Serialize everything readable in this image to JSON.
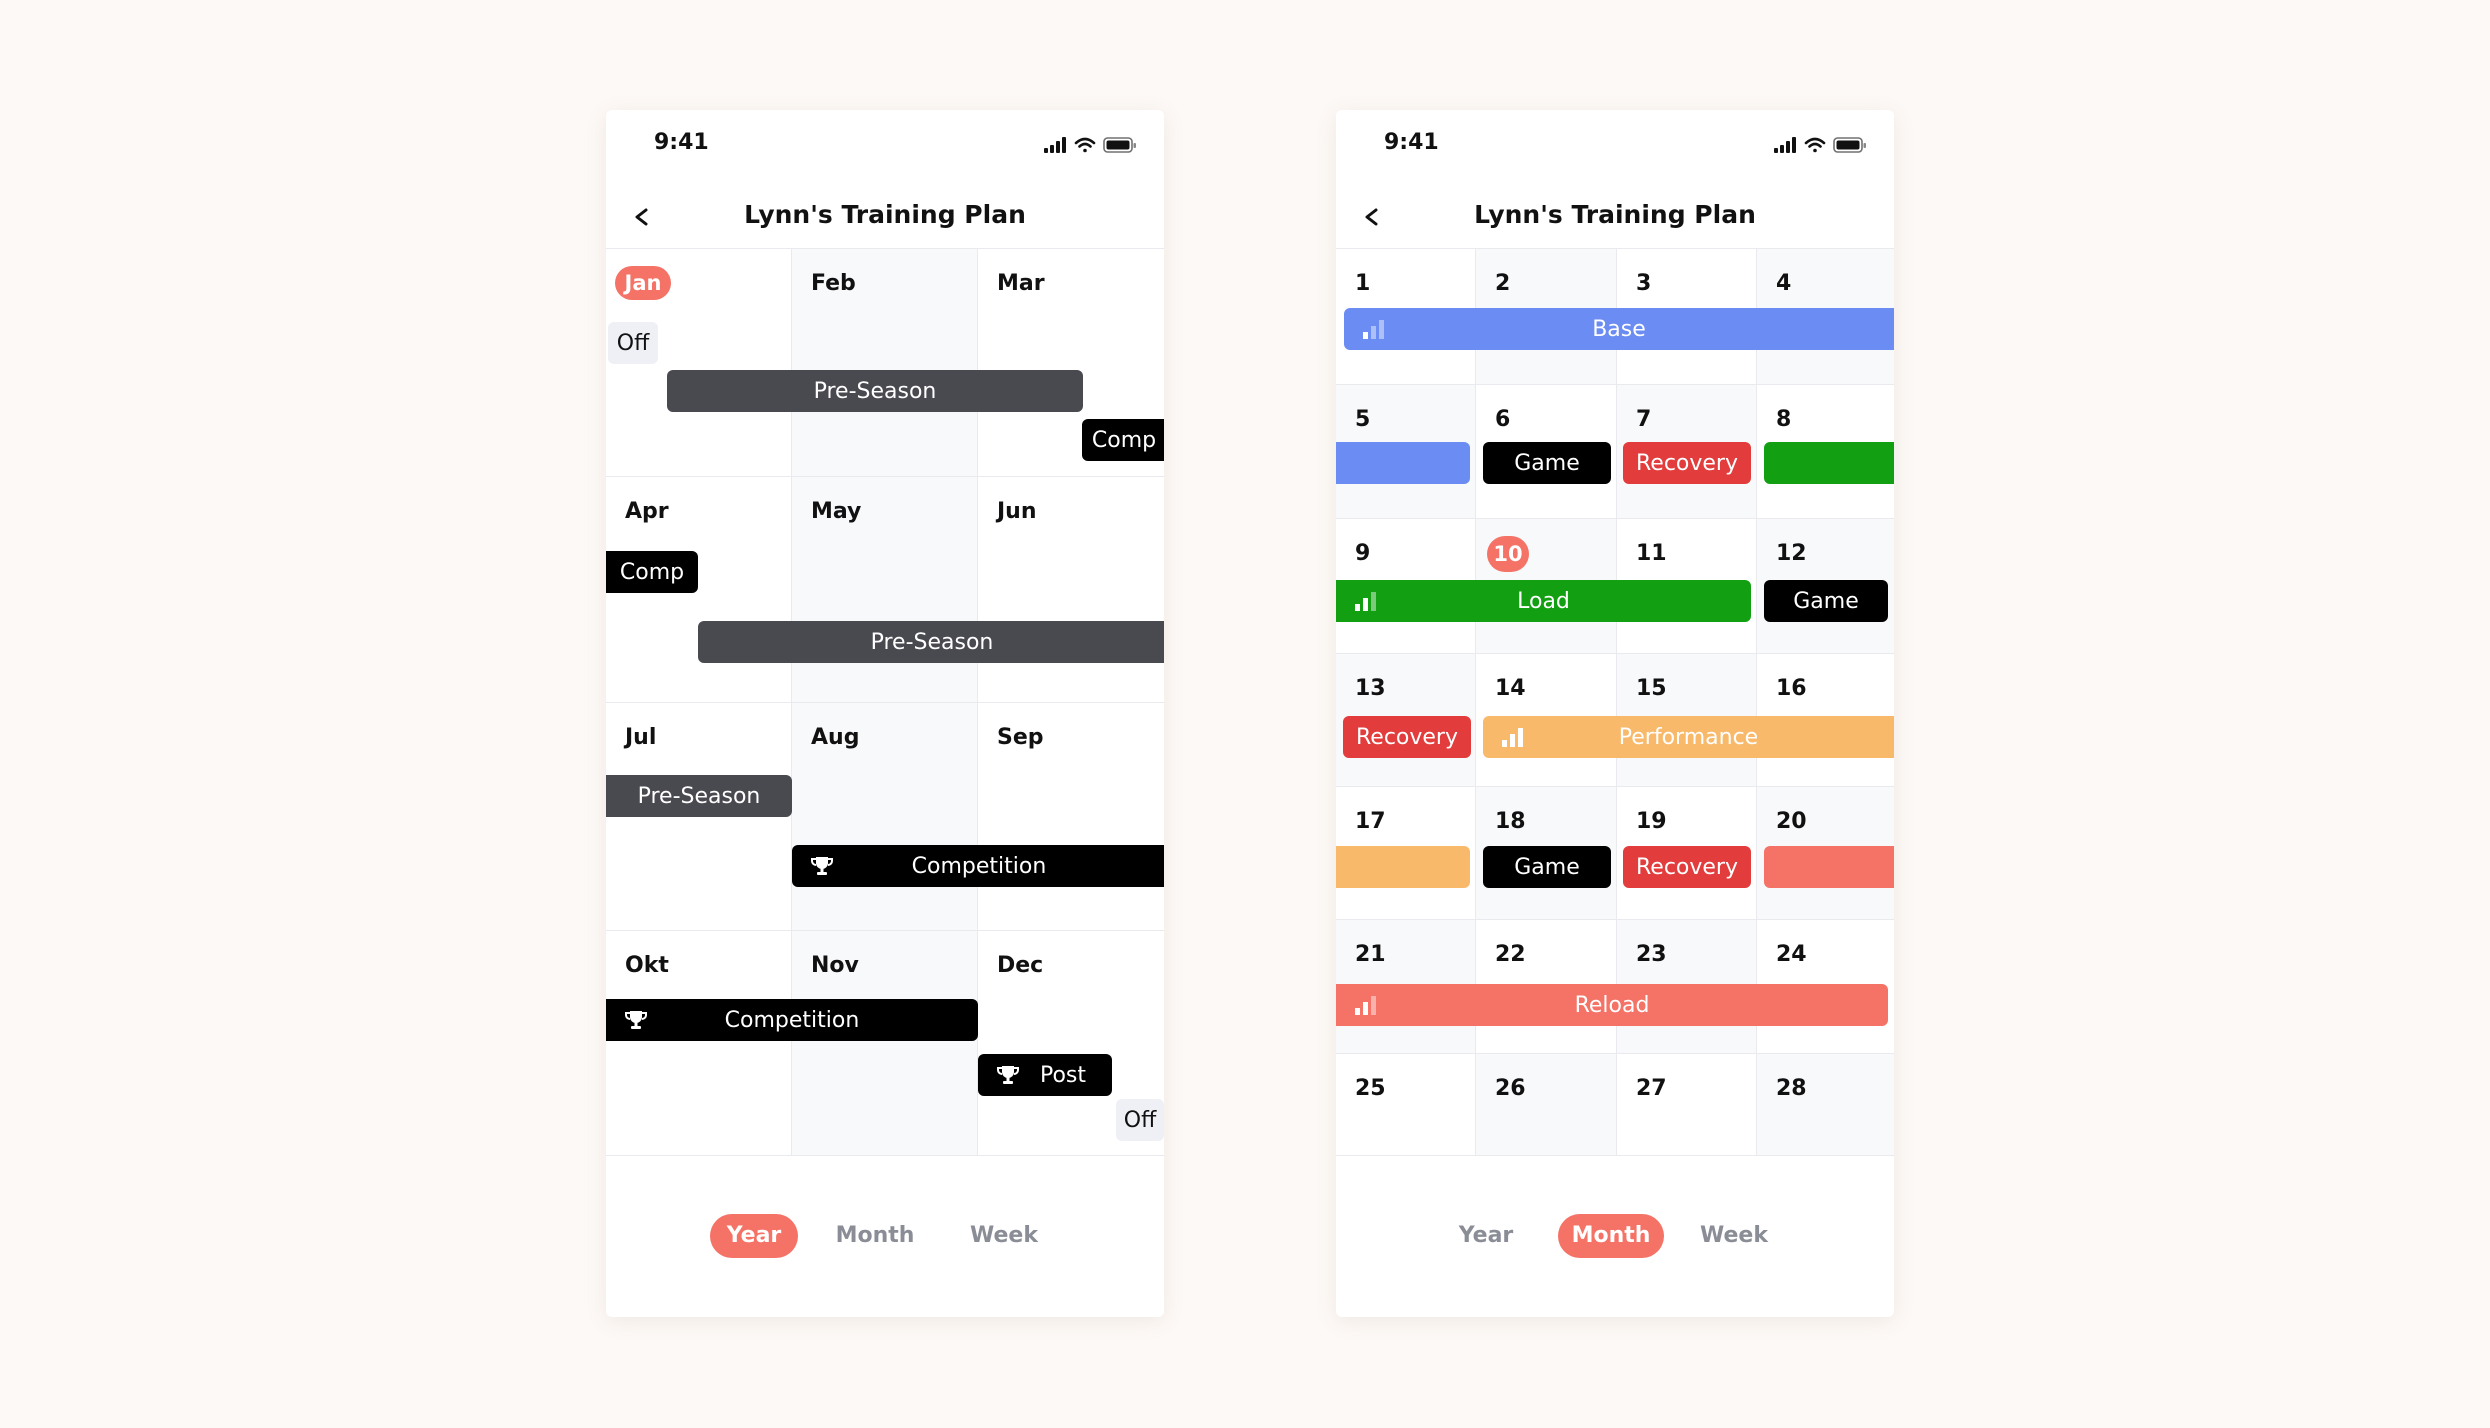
{
  "year_view": {
    "status_time": "9:41",
    "title": "Lynn's Training Plan",
    "months": [
      "Jan",
      "Feb",
      "Mar",
      "Apr",
      "May",
      "Jun",
      "Jul",
      "Aug",
      "Sep",
      "Okt",
      "Nov",
      "Dec"
    ],
    "current_month": "Jan",
    "events": {
      "off_1": "Off",
      "preseason_1": "Pre-Season",
      "comp_1": "Comp",
      "comp_2": "Comp",
      "preseason_2": "Pre-Season",
      "preseason_3": "Pre-Season",
      "competition_1": "Competition",
      "competition_2": "Competition",
      "post": "Post",
      "off_2": "Off"
    },
    "tabs": {
      "year": "Year",
      "month": "Month",
      "week": "Week"
    },
    "active_tab": "Year"
  },
  "month_view": {
    "status_time": "9:41",
    "title": "Lynn's Training Plan",
    "days": [
      "1",
      "2",
      "3",
      "4",
      "5",
      "6",
      "7",
      "8",
      "9",
      "10",
      "11",
      "12",
      "13",
      "14",
      "15",
      "16",
      "17",
      "18",
      "19",
      "20",
      "21",
      "22",
      "23",
      "24",
      "25",
      "26",
      "27",
      "28"
    ],
    "today": "10",
    "events": {
      "base": "Base",
      "game_1": "Game",
      "recovery_1": "Recovery",
      "load": "Load",
      "game_2": "Game",
      "recovery_2": "Recovery",
      "performance": "Performance",
      "game_3": "Game",
      "recovery_3": "Recovery",
      "reload": "Reload"
    },
    "tabs": {
      "year": "Year",
      "month": "Month",
      "week": "Week"
    },
    "active_tab": "Month"
  },
  "colors": {
    "accent": "#f47266",
    "preseason": "#494950",
    "competition": "#000000",
    "base": "#6b8cf2",
    "load": "#12a012",
    "recovery": "#e23c3c",
    "performance": "#f8b96a",
    "reload": "#f47266",
    "game": "#000000"
  },
  "icons": [
    "chevron-left-icon",
    "signal-icon",
    "wifi-icon",
    "battery-icon",
    "trophy-icon",
    "intensity-bars-icon"
  ]
}
